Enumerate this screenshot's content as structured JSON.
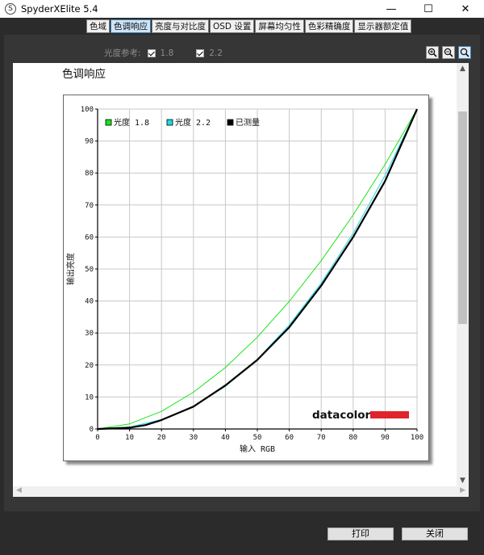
{
  "window": {
    "title": "SpyderXElite 5.4",
    "icon_name": "spyder-app-icon",
    "minimize": "—",
    "maximize": "☐",
    "close": "✕"
  },
  "tabs": [
    {
      "label": "色域",
      "active": false
    },
    {
      "label": "色调响应",
      "active": true
    },
    {
      "label": "亮度与对比度",
      "active": false
    },
    {
      "label": "OSD 设置",
      "active": false
    },
    {
      "label": "屏幕均匀性",
      "active": false
    },
    {
      "label": "色彩精确度",
      "active": false
    },
    {
      "label": "显示器额定值",
      "active": false
    }
  ],
  "reference": {
    "label": "光度参考:",
    "options": [
      {
        "value": "1.8",
        "checked": true
      },
      {
        "value": "2.2",
        "checked": true
      }
    ]
  },
  "zoom": {
    "icons": [
      "zoom-in-icon",
      "zoom-out-icon",
      "zoom-fit-icon"
    ]
  },
  "report": {
    "title": "色调响应",
    "brand": "datacolor",
    "brand_color": "#e0242b"
  },
  "chart_data": {
    "type": "line",
    "xlabel": "输入 RGB",
    "ylabel": "输出亮度",
    "xlim": [
      0,
      100
    ],
    "ylim": [
      0,
      100
    ],
    "xticks": [
      0,
      10,
      20,
      30,
      40,
      50,
      60,
      70,
      80,
      90,
      100
    ],
    "yticks": [
      0,
      10,
      20,
      30,
      40,
      50,
      60,
      70,
      80,
      90,
      100
    ],
    "grid": true,
    "legend_position": "top-left",
    "series": [
      {
        "name": "光度 1.8",
        "color": "#19e419",
        "x": [
          0,
          10,
          20,
          30,
          40,
          50,
          60,
          70,
          80,
          90,
          100
        ],
        "y": [
          0,
          1.6,
          5.5,
          11.5,
          19.2,
          28.7,
          39.9,
          52.6,
          66.9,
          82.7,
          100
        ]
      },
      {
        "name": "光度 2.2",
        "color": "#1fd8e6",
        "x": [
          0,
          10,
          20,
          30,
          40,
          50,
          60,
          70,
          80,
          90,
          100
        ],
        "y": [
          0,
          0.6,
          2.9,
          7.1,
          13.3,
          21.8,
          32.5,
          45.6,
          61.2,
          79.3,
          100
        ]
      },
      {
        "name": "已测量",
        "color": "#000000",
        "x": [
          0,
          10,
          15,
          20,
          30,
          40,
          50,
          60,
          70,
          80,
          90,
          100
        ],
        "y": [
          0,
          0.4,
          1.2,
          2.8,
          7.0,
          13.6,
          21.6,
          31.8,
          44.8,
          60.0,
          77.5,
          100
        ]
      }
    ]
  },
  "buttons": {
    "print": "打印",
    "close": "关闭"
  }
}
